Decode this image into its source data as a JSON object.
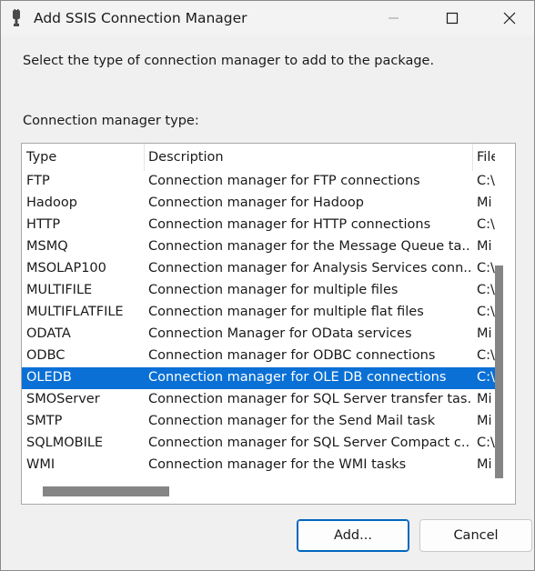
{
  "window": {
    "title": "Add SSIS Connection Manager",
    "icons": {
      "app": "ssis-plug-icon",
      "minimize": "minimize-icon",
      "maximize": "maximize-icon",
      "close": "close-icon"
    }
  },
  "prompt": "Select the type of connection manager to add to the package.",
  "list_label": "Connection manager type:",
  "columns": {
    "type": "Type",
    "description": "Description",
    "file": "File"
  },
  "rows": [
    {
      "type": "FTP",
      "description": "Connection manager for FTP connections",
      "file": "C:\\"
    },
    {
      "type": "Hadoop",
      "description": "Connection manager for Hadoop",
      "file": "Mi"
    },
    {
      "type": "HTTP",
      "description": "Connection manager for HTTP connections",
      "file": "C:\\"
    },
    {
      "type": "MSMQ",
      "description": "Connection manager for the Message Queue ta...",
      "file": "Mi"
    },
    {
      "type": "MSOLAP100",
      "description": "Connection manager for Analysis Services conn...",
      "file": "C:\\"
    },
    {
      "type": "MULTIFILE",
      "description": "Connection manager for multiple files",
      "file": "C:\\"
    },
    {
      "type": "MULTIFLATFILE",
      "description": "Connection manager for multiple flat files",
      "file": "C:\\"
    },
    {
      "type": "ODATA",
      "description": "Connection Manager for OData services",
      "file": "Mi"
    },
    {
      "type": "ODBC",
      "description": "Connection manager for ODBC connections",
      "file": "C:\\"
    },
    {
      "type": "OLEDB",
      "description": "Connection manager for OLE DB connections",
      "file": "C:\\"
    },
    {
      "type": "SMOServer",
      "description": "Connection manager for SQL Server transfer tas...",
      "file": "Mi"
    },
    {
      "type": "SMTP",
      "description": "Connection manager for the Send Mail task",
      "file": "Mi"
    },
    {
      "type": "SQLMOBILE",
      "description": "Connection manager for SQL Server Compact c...",
      "file": "C:\\"
    },
    {
      "type": "WMI",
      "description": "Connection manager for the WMI tasks",
      "file": "Mi"
    }
  ],
  "selected_type": "OLEDB",
  "buttons": {
    "add": "Add...",
    "cancel": "Cancel"
  },
  "colors": {
    "selection": "#0a70d5",
    "default_button_border": "#0067c0",
    "scroll_thumb": "#858585"
  }
}
